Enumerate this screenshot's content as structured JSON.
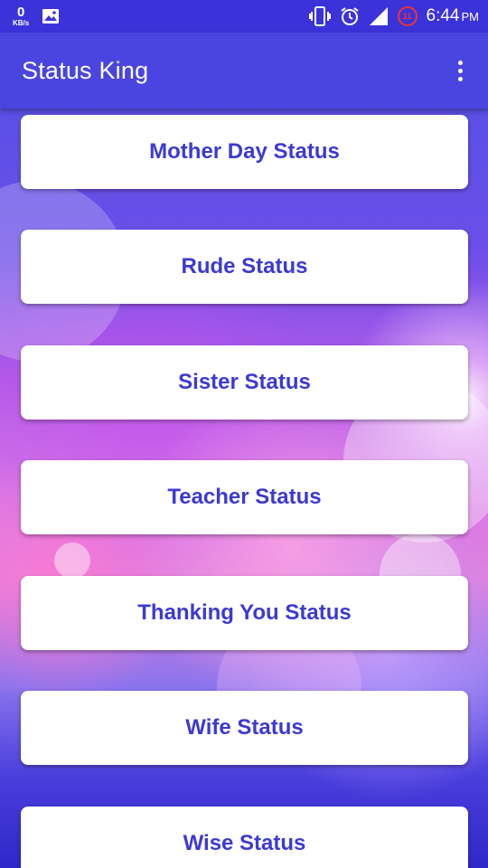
{
  "status_bar": {
    "net_speed_value": "0",
    "net_speed_unit": "KB/s",
    "notification_badge": "11",
    "time": "6:44",
    "ampm": "PM"
  },
  "app_bar": {
    "title": "Status King"
  },
  "categories": [
    "Mother Day Status",
    "Rude Status",
    "Sister Status",
    "Teacher Status",
    "Thanking You Status",
    "Wife Status",
    "Wise Status"
  ],
  "colors": {
    "primary": "#4a44e0",
    "status_bar": "#3b33d9",
    "card_text": "#3c3ad2"
  }
}
